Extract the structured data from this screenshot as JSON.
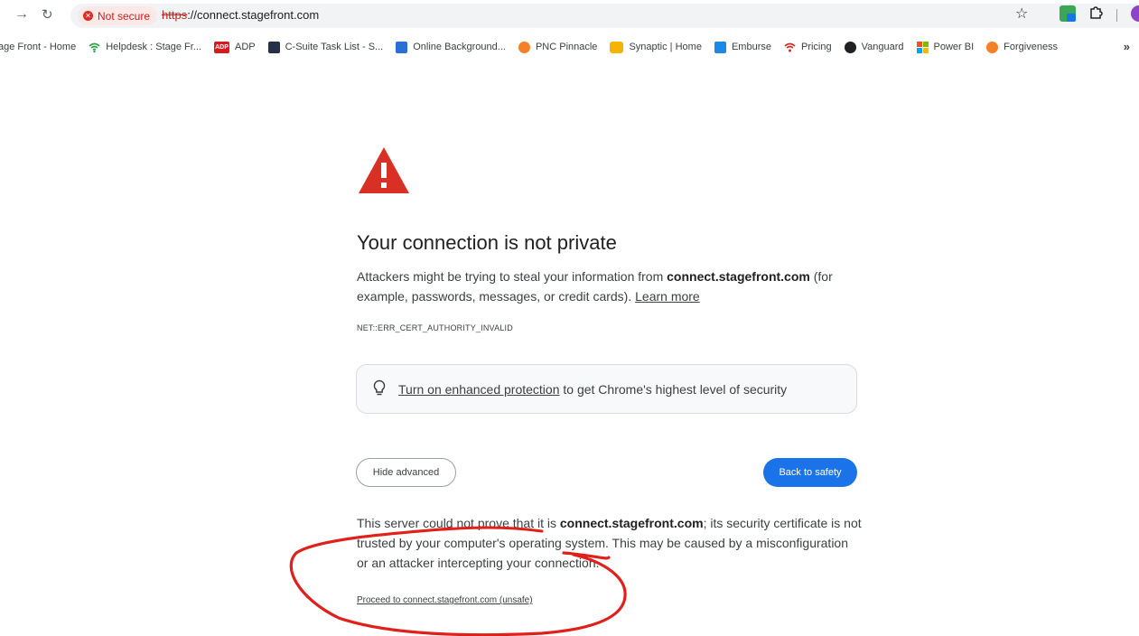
{
  "toolbar": {
    "forward_icon": "arrow-right-icon",
    "reload_icon": "reload-icon",
    "security_chip_label": "Not secure",
    "url_scheme": "https",
    "url_rest": "://connect.stagefront.com",
    "colors": {
      "chip_bg": "#fce8e6",
      "chip_text": "#c5221f"
    }
  },
  "bookmarks": {
    "items": [
      {
        "label": "age Front - Home",
        "icon": "none"
      },
      {
        "label": "Helpdesk : Stage Fr...",
        "icon": "helpdesk-icon"
      },
      {
        "label": "ADP",
        "icon": "adp-icon"
      },
      {
        "label": "C-Suite Task List - S...",
        "icon": "task-icon"
      },
      {
        "label": "Online Background...",
        "icon": "doc-icon"
      },
      {
        "label": "PNC Pinnacle",
        "icon": "pnc-icon"
      },
      {
        "label": "Synaptic | Home",
        "icon": "synaptic-icon"
      },
      {
        "label": "Emburse",
        "icon": "emburse-icon"
      },
      {
        "label": "Pricing",
        "icon": "pricing-icon"
      },
      {
        "label": "Vanguard",
        "icon": "vanguard-icon"
      },
      {
        "label": "Power BI",
        "icon": "powerbi-icon"
      },
      {
        "label": "Forgiveness",
        "icon": "forgiveness-icon"
      }
    ],
    "more_label": "»"
  },
  "interstitial": {
    "heading": "Your connection is not private",
    "desc_prefix": "Attackers might be trying to steal your information from ",
    "desc_host": "connect.stagefront.com",
    "desc_suffix": " (for example, passwords, messages, or credit cards). ",
    "learn_more": "Learn more",
    "error_code": "NET::ERR_CERT_AUTHORITY_INVALID",
    "enhanced_link": "Turn on enhanced protection",
    "enhanced_rest": " to get Chrome's highest level of security",
    "hide_advanced": "Hide advanced",
    "back_to_safety": "Back to safety",
    "adv_prefix": "This server could not prove that it is ",
    "adv_host": "connect.stagefront.com",
    "adv_suffix": "; its security certificate is not trusted by your computer's operating system. This may be caused by a misconfiguration or an attacker intercepting your connection.",
    "proceed_link": "Proceed to connect.stagefront.com (unsafe)",
    "colors": {
      "warning_red": "#d93025",
      "button_blue": "#1a73e8",
      "annotation_red": "#e0201b"
    }
  }
}
